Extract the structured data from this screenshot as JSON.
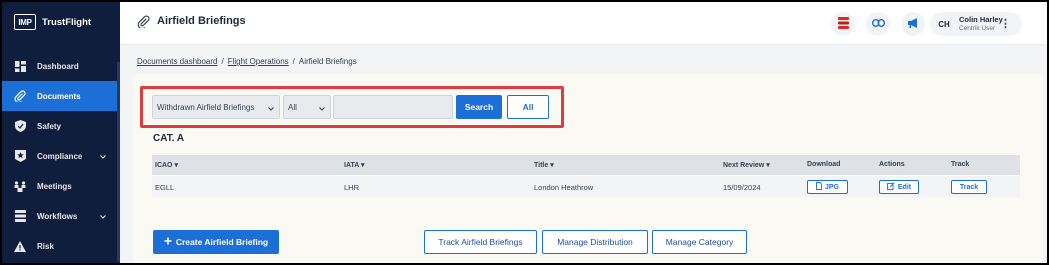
{
  "sidebar": {
    "logo_text": "IMP",
    "brand": "TrustFlight",
    "items": [
      {
        "label": "Dashboard",
        "icon": "dashboard-icon"
      },
      {
        "label": "Documents",
        "icon": "paperclip-icon",
        "active": true
      },
      {
        "label": "Safety",
        "icon": "shield-icon"
      },
      {
        "label": "Compliance",
        "icon": "star-badge-icon",
        "expandable": true
      },
      {
        "label": "Meetings",
        "icon": "meetings-icon"
      },
      {
        "label": "Workflows",
        "icon": "workflows-icon",
        "expandable": true
      },
      {
        "label": "Risk",
        "icon": "warning-icon"
      }
    ]
  },
  "header": {
    "title": "Airfield Briefings",
    "user_initials": "CH",
    "user_name": "Colin Harley",
    "user_role": "Centrik User",
    "buttons": [
      "stack-icon",
      "link-icon",
      "megaphone-icon"
    ]
  },
  "breadcrumb": {
    "items": [
      "Documents dashboard",
      "Flight Operations",
      "Airfield Briefings"
    ],
    "separator": "/"
  },
  "filters": {
    "status_select": "Withdrawn Airfield Briefings",
    "category_select": "All",
    "search_value": "",
    "search_label": "Search",
    "all_label": "All"
  },
  "section": {
    "title": "CAT. A"
  },
  "table": {
    "columns": [
      "ICAO",
      "IATA",
      "Title",
      "Next Review",
      "Download",
      "Actions",
      "Track"
    ],
    "rows": [
      {
        "icao": "EGLL",
        "iata": "LHR",
        "title": "London Heathrow",
        "next_review": "15/09/2024",
        "download": "JPG",
        "action": "Edit",
        "track": "Track"
      }
    ]
  },
  "actions": {
    "create": "Create Airfield Briefing",
    "track": "Track Airfield Briefings",
    "distribution": "Manage Distribution",
    "category": "Manage Category"
  },
  "colors": {
    "sidebar_bg": "#0f1e3c",
    "accent": "#1d6fd8",
    "highlight_border": "#dc3c3c"
  }
}
